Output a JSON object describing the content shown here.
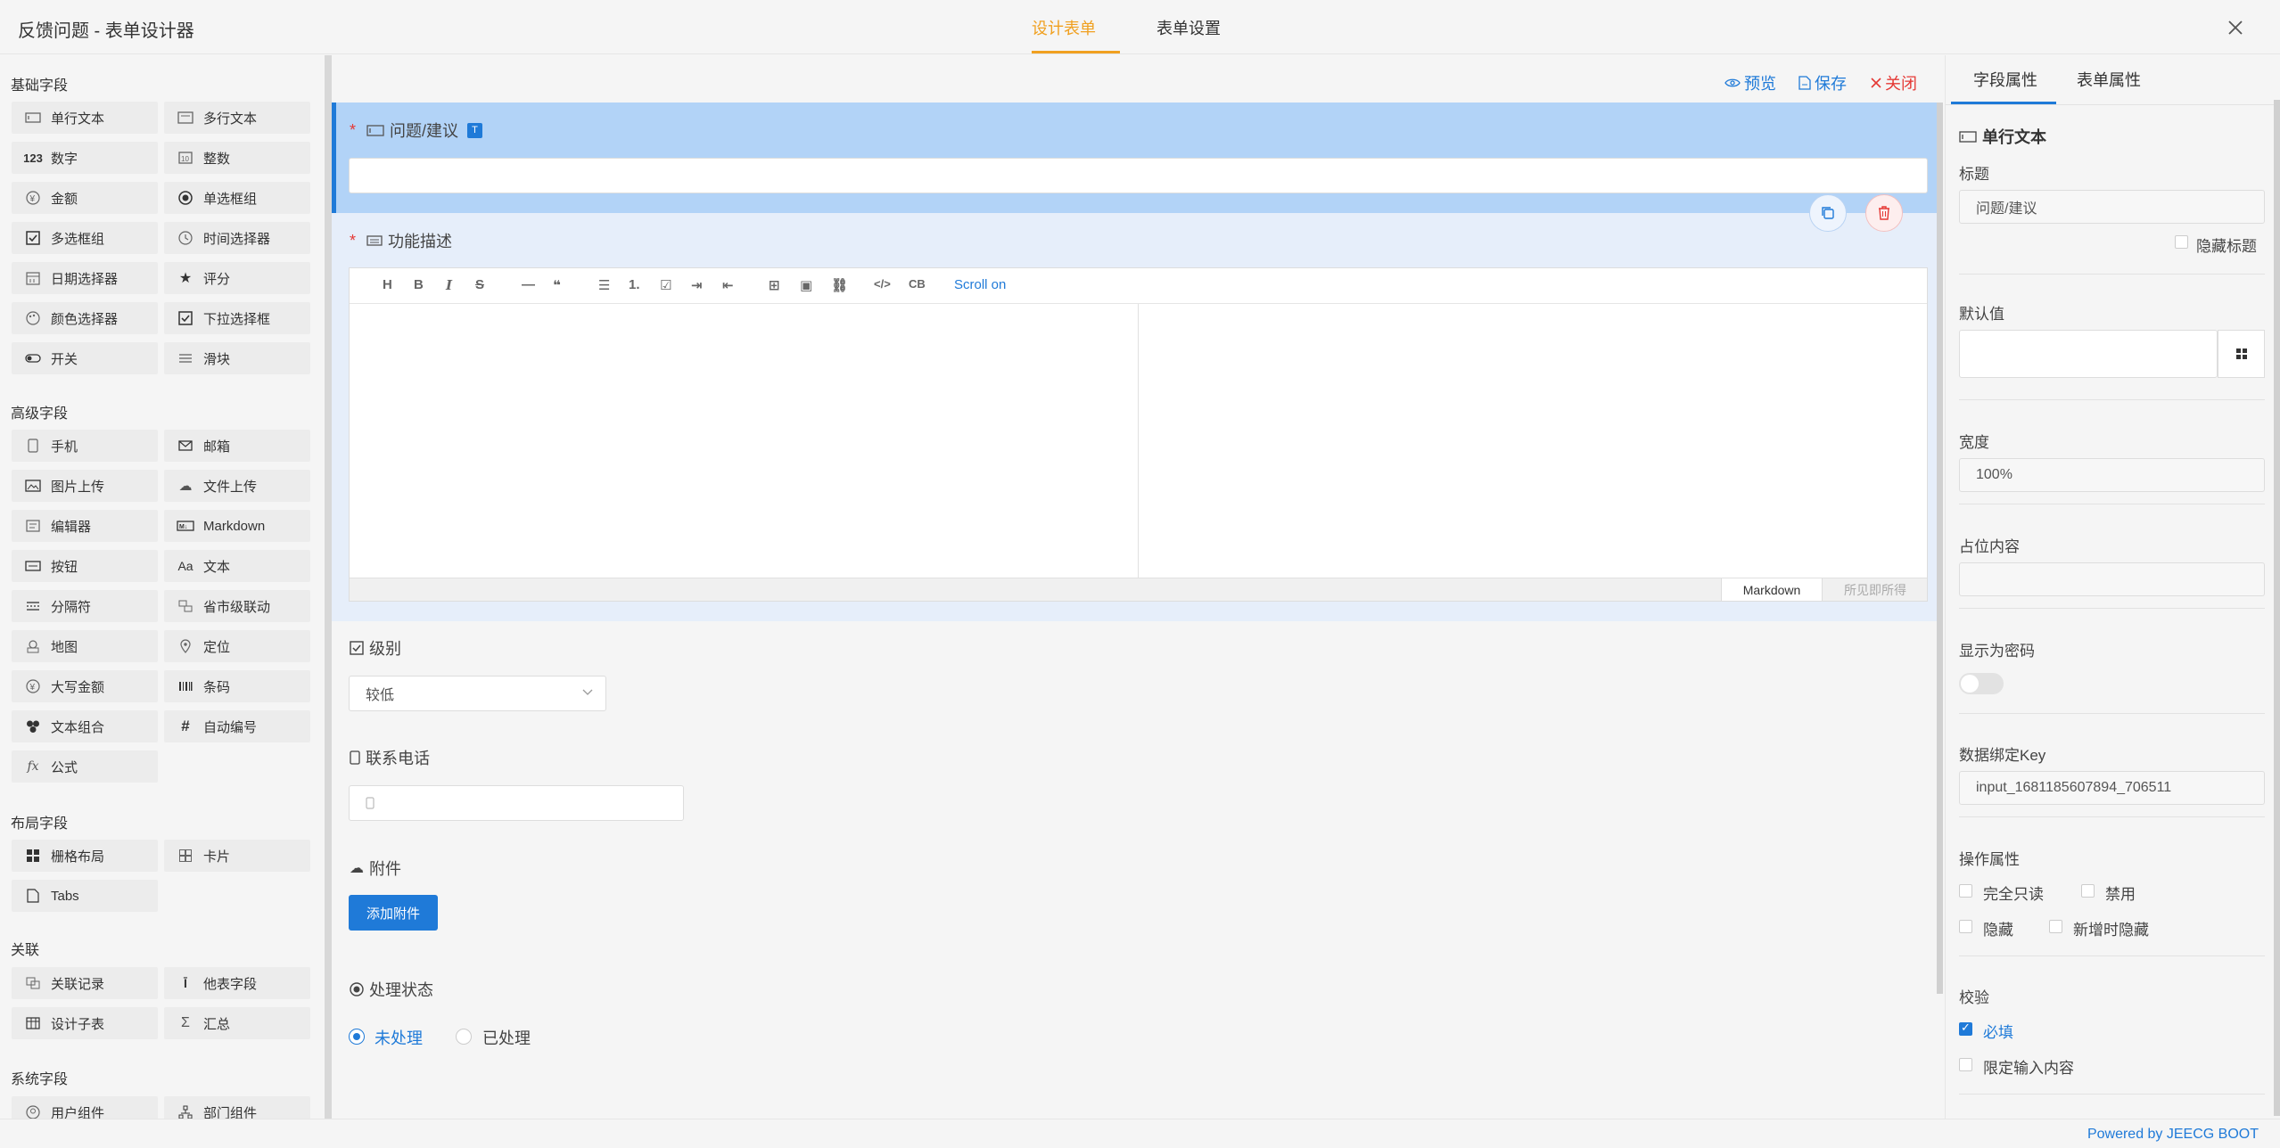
{
  "header": {
    "title": "反馈问题 - 表单设计器",
    "tabs": [
      {
        "label": "设计表单",
        "active": true
      },
      {
        "label": "表单设置",
        "active": false
      }
    ],
    "close_icon": "close-icon"
  },
  "sidebar": {
    "groups": [
      {
        "title": "基础字段",
        "items": [
          {
            "label": "单行文本",
            "icon": "single-line-icon"
          },
          {
            "label": "多行文本",
            "icon": "multi-line-icon"
          },
          {
            "label": "数字",
            "icon": "number-icon"
          },
          {
            "label": "整数",
            "icon": "integer-icon"
          },
          {
            "label": "金额",
            "icon": "money-icon"
          },
          {
            "label": "单选框组",
            "icon": "radio-icon"
          },
          {
            "label": "多选框组",
            "icon": "checkbox-icon"
          },
          {
            "label": "时间选择器",
            "icon": "clock-icon"
          },
          {
            "label": "日期选择器",
            "icon": "calendar-icon"
          },
          {
            "label": "评分",
            "icon": "star-icon"
          },
          {
            "label": "颜色选择器",
            "icon": "palette-icon"
          },
          {
            "label": "下拉选择框",
            "icon": "dropdown-icon"
          },
          {
            "label": "开关",
            "icon": "switch-icon"
          },
          {
            "label": "滑块",
            "icon": "slider-icon"
          }
        ]
      },
      {
        "title": "高级字段",
        "items": [
          {
            "label": "手机",
            "icon": "phone-icon"
          },
          {
            "label": "邮箱",
            "icon": "mail-icon"
          },
          {
            "label": "图片上传",
            "icon": "image-icon"
          },
          {
            "label": "文件上传",
            "icon": "cloud-upload-icon"
          },
          {
            "label": "编辑器",
            "icon": "editor-icon"
          },
          {
            "label": "Markdown",
            "icon": "markdown-icon"
          },
          {
            "label": "按钮",
            "icon": "button-icon"
          },
          {
            "label": "文本",
            "icon": "text-icon"
          },
          {
            "label": "分隔符",
            "icon": "divider-icon"
          },
          {
            "label": "省市级联动",
            "icon": "cascade-icon"
          },
          {
            "label": "地图",
            "icon": "map-icon"
          },
          {
            "label": "定位",
            "icon": "location-icon"
          },
          {
            "label": "大写金额",
            "icon": "capital-money-icon"
          },
          {
            "label": "条码",
            "icon": "barcode-icon"
          },
          {
            "label": "文本组合",
            "icon": "combo-icon"
          },
          {
            "label": "自动编号",
            "icon": "hash-icon"
          },
          {
            "label": "公式",
            "icon": "formula-icon"
          }
        ]
      },
      {
        "title": "布局字段",
        "items": [
          {
            "label": "栅格布局",
            "icon": "grid-icon"
          },
          {
            "label": "卡片",
            "icon": "card-icon"
          },
          {
            "label": "Tabs",
            "icon": "tabs-icon"
          }
        ]
      },
      {
        "title": "关联",
        "items": [
          {
            "label": "关联记录",
            "icon": "link-record-icon"
          },
          {
            "label": "他表字段",
            "icon": "other-table-icon"
          },
          {
            "label": "设计子表",
            "icon": "subtable-icon"
          },
          {
            "label": "汇总",
            "icon": "sum-icon"
          }
        ]
      },
      {
        "title": "系统字段",
        "items": [
          {
            "label": "用户组件",
            "icon": "user-icon"
          },
          {
            "label": "部门组件",
            "icon": "org-icon"
          }
        ]
      }
    ]
  },
  "toolbar": {
    "preview": "预览",
    "save": "保存",
    "close": "关闭"
  },
  "form": {
    "field1": {
      "label": "问题/建议",
      "badge": "T"
    },
    "field2": {
      "label": "功能描述"
    },
    "editor": {
      "tools": [
        "H",
        "B",
        "I",
        "S",
        "—",
        "❝",
        "☰",
        "1.",
        "☑",
        "⇥",
        "⇤",
        "⊞",
        "▣",
        "⛓",
        "</>",
        "CB"
      ],
      "scroll_on": "Scroll on",
      "mode_markdown": "Markdown",
      "mode_wysiwyg": "所见即所得"
    },
    "level": {
      "label": "级别",
      "value": "较低"
    },
    "phone": {
      "label": "联系电话"
    },
    "attach": {
      "label": "附件",
      "button": "添加附件"
    },
    "status": {
      "label": "处理状态",
      "options": [
        {
          "label": "未处理",
          "checked": true
        },
        {
          "label": "已处理",
          "checked": false
        }
      ]
    }
  },
  "right_panel": {
    "tabs": [
      {
        "label": "字段属性",
        "active": true
      },
      {
        "label": "表单属性",
        "active": false
      }
    ],
    "field_type": "单行文本",
    "title_label": "标题",
    "title_value": "问题/建议",
    "hide_title": "隐藏标题",
    "default_label": "默认值",
    "width_label": "宽度",
    "width_value": "100%",
    "placeholder_label": "占位内容",
    "password_label": "显示为密码",
    "key_label": "数据绑定Key",
    "key_value": "input_1681185607894_706511",
    "ops_label": "操作属性",
    "ops": {
      "readonly": "完全只读",
      "disabled": "禁用",
      "hidden": "隐藏",
      "hide_on_add": "新增时隐藏"
    },
    "validate_label": "校验",
    "validate": {
      "required": "必填",
      "limit": "限定输入内容"
    }
  },
  "footer": {
    "powered": "Powered by JEECG BOOT"
  },
  "colors": {
    "accent": "#1f7ad8",
    "tab_active": "#f0a020",
    "danger": "#e53935"
  }
}
